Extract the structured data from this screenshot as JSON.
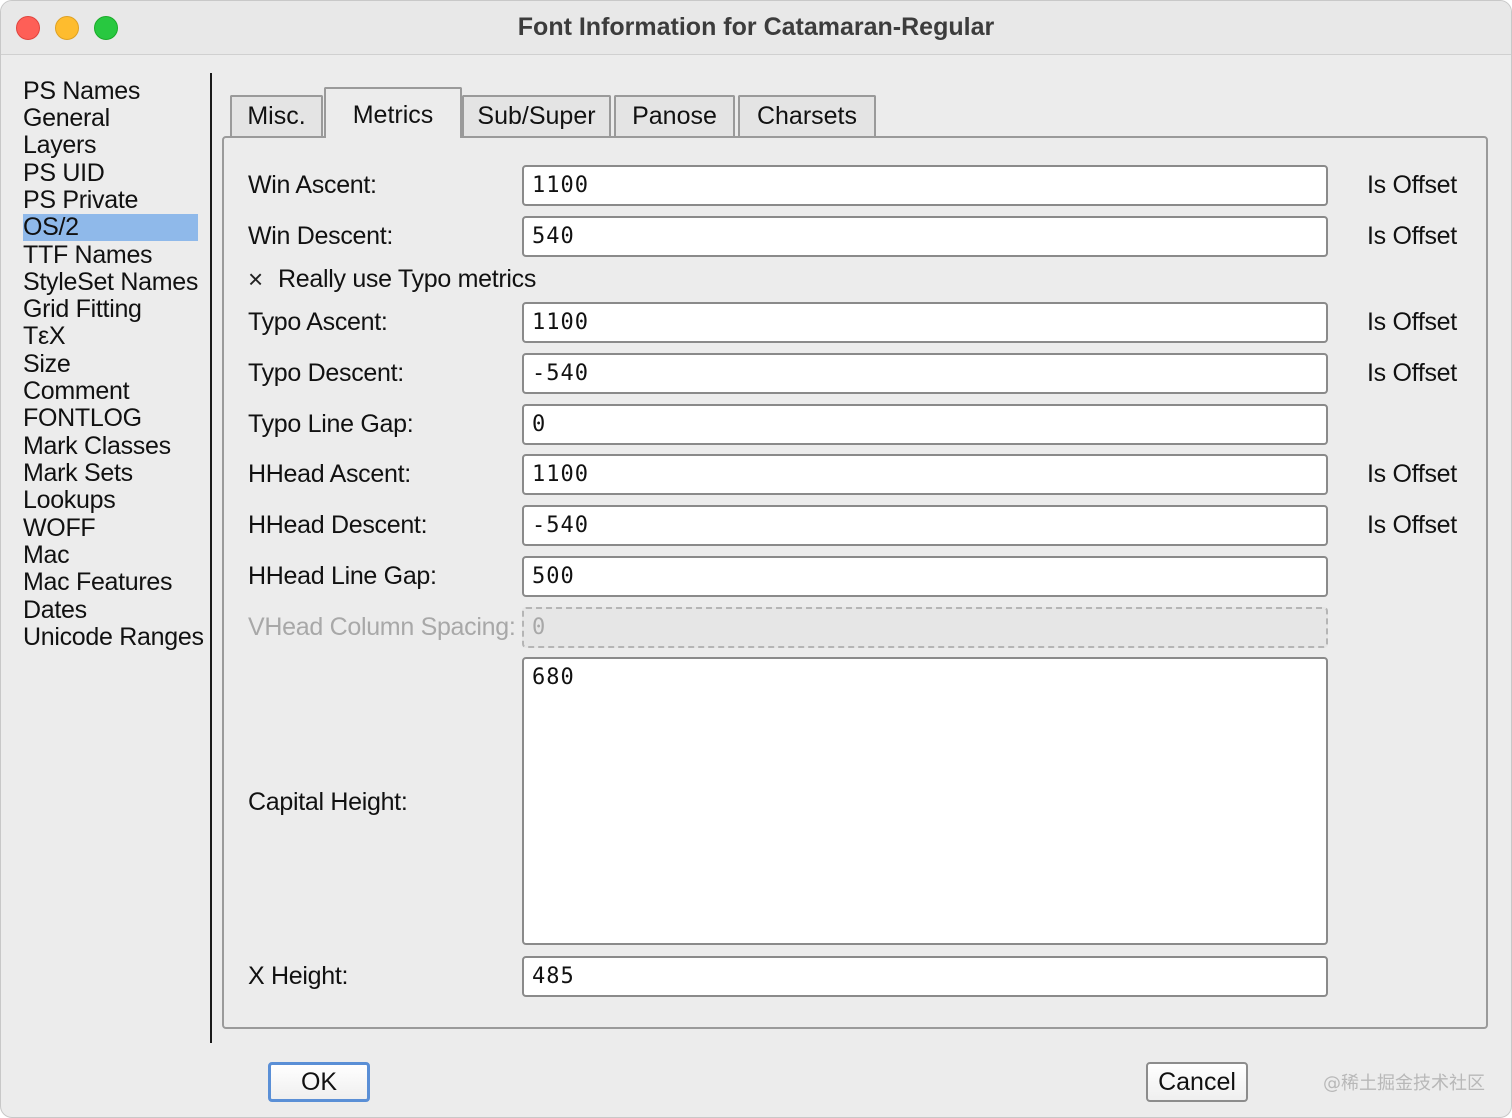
{
  "window": {
    "title": "Font Information for Catamaran-Regular"
  },
  "sidebar": {
    "items": [
      {
        "label": "PS Names"
      },
      {
        "label": "General"
      },
      {
        "label": "Layers"
      },
      {
        "label": "PS UID"
      },
      {
        "label": "PS Private"
      },
      {
        "label": "OS/2",
        "selected": true
      },
      {
        "label": "TTF Names"
      },
      {
        "label": "StyleSet Names"
      },
      {
        "label": "Grid Fitting"
      },
      {
        "label": "TεX"
      },
      {
        "label": "Size"
      },
      {
        "label": "Comment"
      },
      {
        "label": "FONTLOG"
      },
      {
        "label": "Mark Classes"
      },
      {
        "label": "Mark Sets"
      },
      {
        "label": "Lookups"
      },
      {
        "label": "WOFF"
      },
      {
        "label": "Mac"
      },
      {
        "label": "Mac Features"
      },
      {
        "label": "Dates"
      },
      {
        "label": "Unicode Ranges"
      }
    ],
    "selected_color": "#8fb9ea"
  },
  "tabs": [
    {
      "label": "Misc."
    },
    {
      "label": "Metrics",
      "active": true
    },
    {
      "label": "Sub/Super"
    },
    {
      "label": "Panose"
    },
    {
      "label": "Charsets"
    }
  ],
  "metrics": {
    "win_ascent": {
      "label": "Win Ascent:",
      "value": "1100",
      "offset_label": "Is Offset"
    },
    "win_descent": {
      "label": "Win Descent:",
      "value": "540",
      "offset_label": "Is Offset"
    },
    "really_use_typo": {
      "label": "Really use Typo metrics",
      "mark": "×",
      "checked": true
    },
    "typo_ascent": {
      "label": "Typo Ascent:",
      "value": "1100",
      "offset_label": "Is Offset"
    },
    "typo_descent": {
      "label": "Typo Descent:",
      "value": "-540",
      "offset_label": "Is Offset"
    },
    "typo_line_gap": {
      "label": "Typo Line Gap:",
      "value": "0"
    },
    "hhead_ascent": {
      "label": "HHead Ascent:",
      "value": "1100",
      "offset_label": "Is Offset"
    },
    "hhead_descent": {
      "label": "HHead Descent:",
      "value": "-540",
      "offset_label": "Is Offset"
    },
    "hhead_line_gap": {
      "label": "HHead Line Gap:",
      "value": "500"
    },
    "vhead_column_spacing": {
      "label": "VHead Column Spacing:",
      "value": "0",
      "disabled": true
    },
    "capital_height": {
      "label": "Capital Height:",
      "value": "680"
    },
    "x_height": {
      "label": "X Height:",
      "value": "485"
    }
  },
  "buttons": {
    "ok": "OK",
    "cancel": "Cancel"
  },
  "watermark": "@稀土掘金技术社区"
}
